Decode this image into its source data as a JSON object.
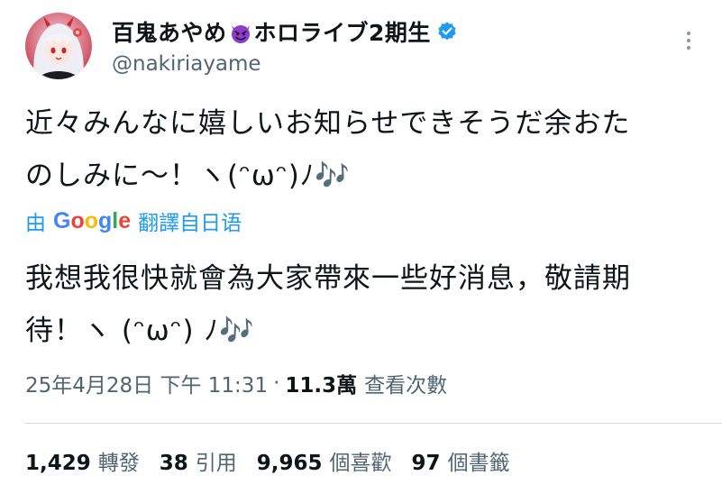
{
  "tweet": {
    "author": {
      "display_name_part1": "百鬼あやめ",
      "display_name_emoji": "smiling-devil-emoji",
      "display_name_part2": "ホロライブ2期生",
      "handle": "@nakiriayame",
      "verified": true
    },
    "text_line1": "近々みんなに嬉しいお知らせできそうだ余おた",
    "text_line2": "のしみに〜！ヽ(ᵔωᵔ)ﾉ🎶",
    "translation": {
      "prefix": "由",
      "brand": "Google",
      "suffix": "翻譯自日语"
    },
    "translated_line1": "我想我很快就會為大家帶來一些好消息，敬請期",
    "translated_line2": "待！ヽ (ᵔωᵔ) ﾉ🎶",
    "meta": {
      "timestamp": "25年4月28日 下午 11:31",
      "separator": "·",
      "views_count": "11.3萬",
      "views_label": "查看次數"
    },
    "stats": [
      {
        "count": "1,429",
        "label": "轉發"
      },
      {
        "count": "38",
        "label": "引用"
      },
      {
        "count": "9,965",
        "label": "個喜歡"
      },
      {
        "count": "97",
        "label": "個書籤"
      }
    ]
  },
  "colors": {
    "accent": "#1d9bf0",
    "secondary_text": "#536471",
    "primary_text": "#0f1419",
    "divider": "#cfd9de",
    "devil_emoji": "#8b3fc7"
  }
}
